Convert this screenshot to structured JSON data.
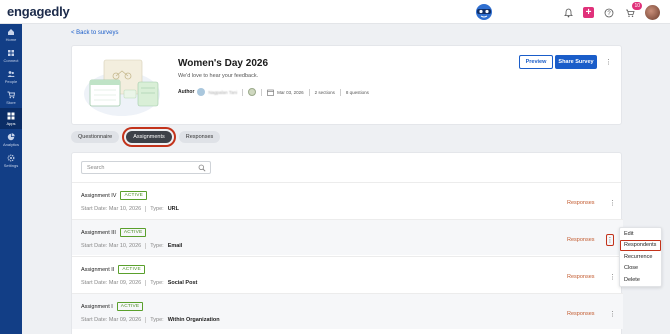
{
  "app": {
    "brand_main": "engaged",
    "brand_tail": "ly",
    "notification_count": "10"
  },
  "sidebar": {
    "items": [
      {
        "label": "Home",
        "icon": "home-icon"
      },
      {
        "label": "Connect",
        "icon": "connect-icon"
      },
      {
        "label": "People",
        "icon": "people-icon"
      },
      {
        "label": "Store",
        "icon": "store-icon"
      },
      {
        "label": "Apps",
        "icon": "apps-icon",
        "active": true
      },
      {
        "label": "Analytics",
        "icon": "analytics-icon"
      },
      {
        "label": "Settings",
        "icon": "settings-icon"
      }
    ]
  },
  "nav": {
    "back_label": "< Back to surveys"
  },
  "survey": {
    "title": "Women's Day 2026",
    "subtitle": "We'd love to hear your feedback.",
    "author_label": "Author",
    "author_name": "Nagpalan Tani",
    "date": "Mar 03, 2026",
    "sections": "2 sections",
    "questions": "8 questions",
    "preview_label": "Preview",
    "share_label": "Share Survey"
  },
  "tabs": [
    {
      "label": "Questionnaire",
      "selected": false
    },
    {
      "label": "Assignments",
      "selected": true
    },
    {
      "label": "Responses",
      "selected": false
    }
  ],
  "search": {
    "placeholder": "Search"
  },
  "assignments": [
    {
      "name": "Assignment IV",
      "status": "ACTIVE",
      "start_label": "Start Date: Mar 10, 2026",
      "type_label": "Type:",
      "type": "URL",
      "responses_label": "Responses"
    },
    {
      "name": "Assignment III",
      "status": "ACTIVE",
      "start_label": "Start Date: Mar 10, 2026",
      "type_label": "Type:",
      "type": "Email",
      "responses_label": "Responses"
    },
    {
      "name": "Assignment II",
      "status": "ACTIVE",
      "start_label": "Start Date: Mar 09, 2026",
      "type_label": "Type:",
      "type": "Social Post",
      "responses_label": "Responses"
    },
    {
      "name": "Assignment I",
      "status": "ACTIVE",
      "start_label": "Start Date: Mar 09, 2026",
      "type_label": "Type:",
      "type": "Within Organization",
      "responses_label": "Responses"
    }
  ],
  "context_menu": {
    "items": [
      "Edit",
      "Respondents",
      "Recurrence",
      "Close",
      "Delete"
    ]
  },
  "colors": {
    "primary": "#1a5dc9",
    "sidebar": "#123e86",
    "active_green": "#4a8d22",
    "highlight": "#c3331b",
    "responses_link": "#c25a2e"
  }
}
